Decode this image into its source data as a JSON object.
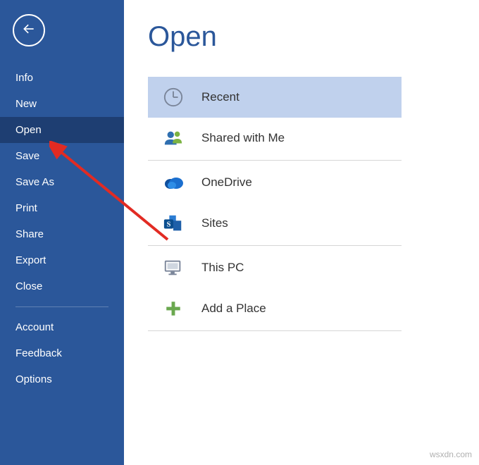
{
  "colors": {
    "accent": "#2b579a",
    "sidebar_selected": "#1e3e72",
    "list_selected": "#c0d1ed",
    "annotation_arrow": "#e22b23"
  },
  "sidebar": {
    "items": [
      {
        "label": "Info"
      },
      {
        "label": "New"
      },
      {
        "label": "Open"
      },
      {
        "label": "Save"
      },
      {
        "label": "Save As"
      },
      {
        "label": "Print"
      },
      {
        "label": "Share"
      },
      {
        "label": "Export"
      },
      {
        "label": "Close"
      }
    ],
    "footer_items": [
      {
        "label": "Account"
      },
      {
        "label": "Feedback"
      },
      {
        "label": "Options"
      }
    ],
    "selected_index": 2
  },
  "main": {
    "title": "Open",
    "locations": [
      {
        "label": "Recent",
        "icon": "clock-icon"
      },
      {
        "label": "Shared with Me",
        "icon": "people-icon"
      },
      {
        "label": "OneDrive",
        "icon": "onedrive-icon"
      },
      {
        "label": "Sites",
        "icon": "sites-icon"
      },
      {
        "label": "This PC",
        "icon": "this-pc-icon"
      },
      {
        "label": "Add a Place",
        "icon": "add-place-icon"
      }
    ],
    "selected_index": 0
  },
  "watermark": "wsxdn.com"
}
